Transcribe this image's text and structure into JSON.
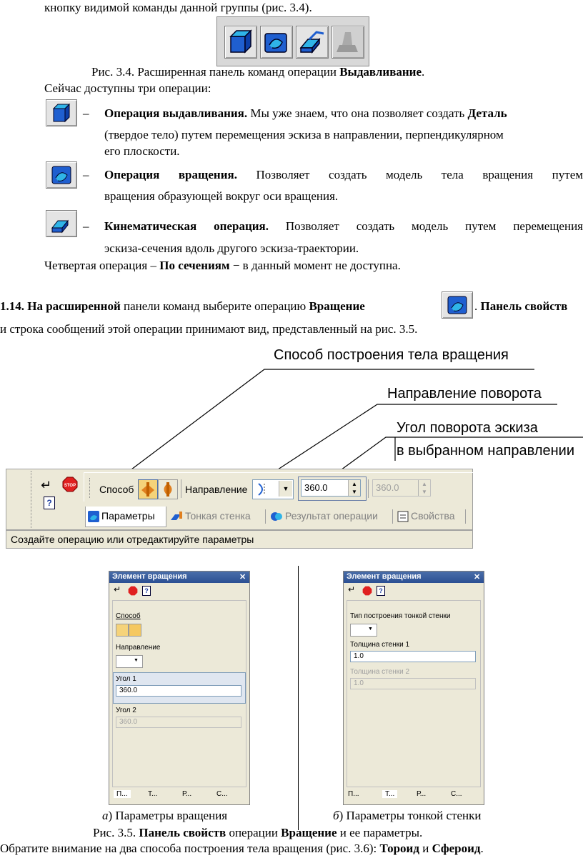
{
  "top_line": "кнопку видимой команды данной группы (рис. 3.4).",
  "fig34": {
    "caption_prefix": "Рис. 3.4. Расширенная панель команд операции ",
    "caption_bold": "Выдавливание",
    "caption_end": "."
  },
  "intro": "Сейчас доступны три операции:",
  "ops": [
    {
      "dash": "–",
      "title": "Операция выдавливания.",
      "line1": " Мы уже знаем, что она позволяет создать ",
      "line1_bold": "Деталь",
      "line2": "(твердое тело) путем перемещения эскиза в направлении, перпендикулярном",
      "line3": "его плоскости."
    },
    {
      "dash": "–",
      "title": "Операция вращения.",
      "line1": " Позволяет создать модель тела вращения путем",
      "line2": "вращения образующей вокруг оси вращения."
    },
    {
      "dash": "–",
      "title": "Кинематическая операция.",
      "line1": " Позволяет создать модель путем перемещения",
      "line2": "эскиза-сечения вдоль другого эскиза-траектории."
    }
  ],
  "fourth": {
    "pre": "Четвертая операция – ",
    "bold": "По сечениям",
    "post": " − в данный момент не доступна."
  },
  "step": {
    "num": "1.14. На расширенной",
    "mid": " панели команд выберите операцию ",
    "op": "Вращение",
    "dot": ".",
    "after": " Панель свойств",
    "line2": "и строка сообщений этой операции принимают вид, представленный на рис. 3.5."
  },
  "callouts": {
    "c1": "Способ построения тела вращения",
    "c2": "Направление поворота",
    "c3a": "Угол поворота эскиза",
    "c3b": "в выбранном направлении"
  },
  "toolbar": {
    "sposob": "Способ",
    "napravlenie": "Направление",
    "angle1": "360.0",
    "angle2": "360.0",
    "tabs": [
      "Параметры",
      "Тонкая стенка",
      "Результат операции",
      "Свойства"
    ],
    "status": "Создайте операцию или отредактируйте параметры"
  },
  "panelA": {
    "title": "Элемент вращения",
    "sposob": "Способ",
    "napravlenie": "Направление",
    "ugol1": "Угол 1",
    "val1": "360.0",
    "ugol2": "Угол 2",
    "val2": "360.0",
    "tabs": [
      "П...",
      "Т...",
      "Р...",
      "С..."
    ]
  },
  "panelB": {
    "title": "Элемент вращения",
    "type_label": "Тип построения тонкой стенки",
    "t1": "Толщина стенки 1",
    "v1": "1.0",
    "t2": "Толщина стенки 2",
    "v2": "1.0",
    "tabs": [
      "П...",
      "Т...",
      "Р...",
      "С..."
    ]
  },
  "captions": {
    "a_letter": "а",
    "a_text": ") Параметры вращения",
    "b_letter": "б",
    "b_text": ") Параметры тонкой стенки",
    "fig35_pre": "Рис. 3.5. ",
    "fig35_b1": "Панель свойств",
    "fig35_mid": " операции ",
    "fig35_b2": "Вращение",
    "fig35_post": " и ее параметры."
  },
  "bottom": {
    "pre": "Обратите внимание на два способа построения тела вращения (рис. 3.6): ",
    "b1": "Тороид",
    "mid": " и ",
    "b2": "Сфероид",
    "post": "."
  },
  "colors": {
    "icon_blue": "#1f5fd0",
    "icon_cyan": "#2fb4e8",
    "panel": "#ece9d8",
    "header": "#2b4f93"
  }
}
